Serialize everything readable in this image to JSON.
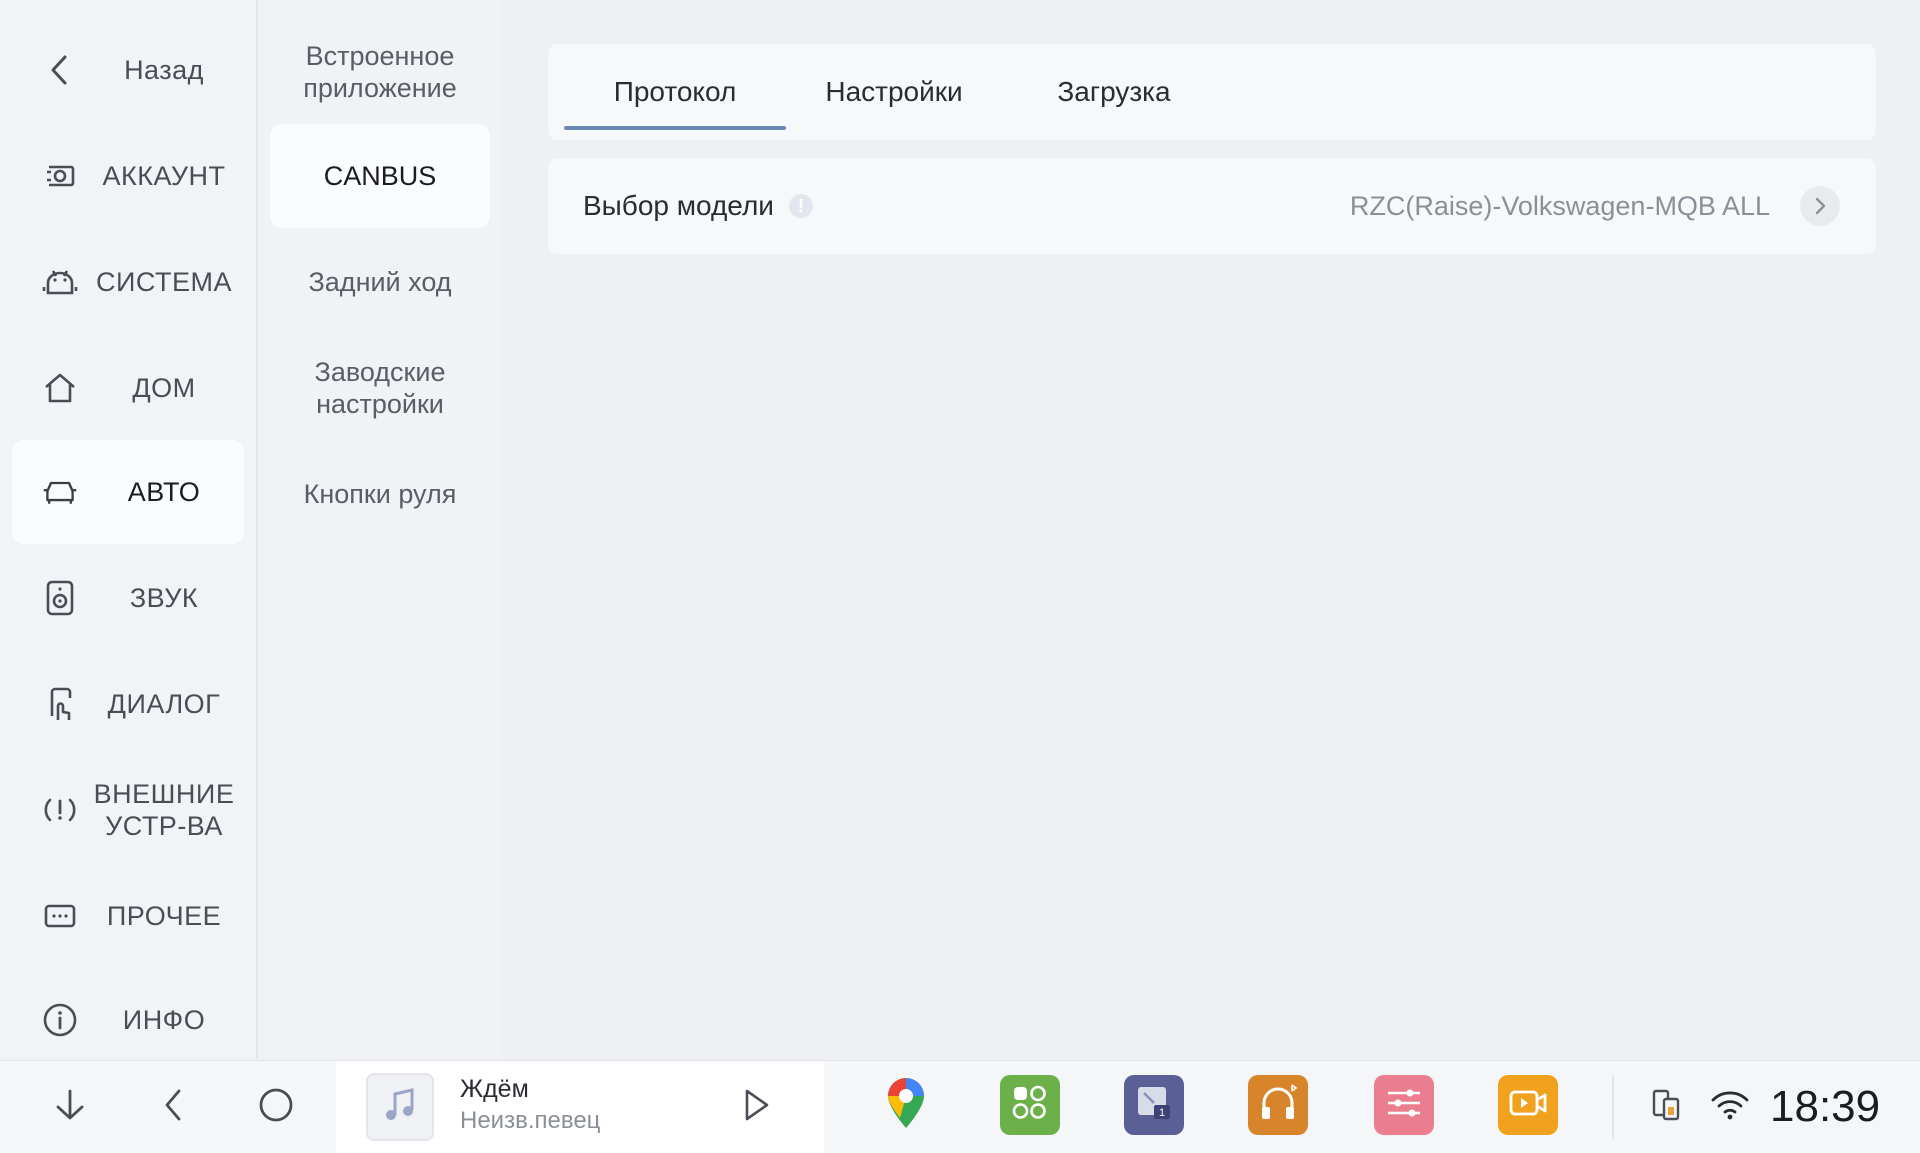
{
  "nav": {
    "back_label": "Назад",
    "items": [
      {
        "label": "АККАУНТ",
        "icon": "account-icon"
      },
      {
        "label": "СИСТЕМА",
        "icon": "android-icon"
      },
      {
        "label": "ДОМ",
        "icon": "home-icon"
      },
      {
        "label": "АВТО",
        "icon": "car-icon",
        "active": true
      },
      {
        "label": "ЗВУК",
        "icon": "speaker-icon"
      },
      {
        "label": "ДИАЛОГ",
        "icon": "touch-icon"
      },
      {
        "label_line1": "ВНЕШНИЕ",
        "label_line2": "УСТР-ВА",
        "icon": "alert-circle-icon"
      },
      {
        "label": "ПРОЧЕЕ",
        "icon": "more-icon"
      },
      {
        "label": "ИНФО",
        "icon": "info-icon"
      }
    ]
  },
  "subnav": {
    "items": [
      {
        "line1": "Встроенное",
        "line2": "приложение"
      },
      {
        "label": "CANBUS",
        "active": true
      },
      {
        "label": "Задний ход"
      },
      {
        "line1": "Заводские",
        "line2": "настройки"
      },
      {
        "label": "Кнопки руля"
      }
    ]
  },
  "tabs": [
    {
      "label": "Протокол",
      "active": true
    },
    {
      "label": "Настройки"
    },
    {
      "label": "Загрузка"
    }
  ],
  "model_row": {
    "label": "Выбор модели",
    "info_glyph": "!",
    "value": "RZC(Raise)-Volkswagen-MQB ALL"
  },
  "media": {
    "title": "Ждём",
    "artist": "Неизв.певец"
  },
  "apps": [
    {
      "icon": "maps-icon",
      "color": "#ffffff"
    },
    {
      "icon": "apps-grid-icon",
      "color": "#6cb04a"
    },
    {
      "icon": "multiwindow-icon",
      "color": "#5a5f96"
    },
    {
      "icon": "bt-music-icon",
      "color": "#d8842a"
    },
    {
      "icon": "equalizer-icon",
      "color": "#ea7e8e"
    },
    {
      "icon": "video-icon",
      "color": "#f0a21f"
    }
  ],
  "status": {
    "clock": "18:39"
  },
  "colors": {
    "accent": "#6c86b8",
    "background": "#eef0f4"
  }
}
